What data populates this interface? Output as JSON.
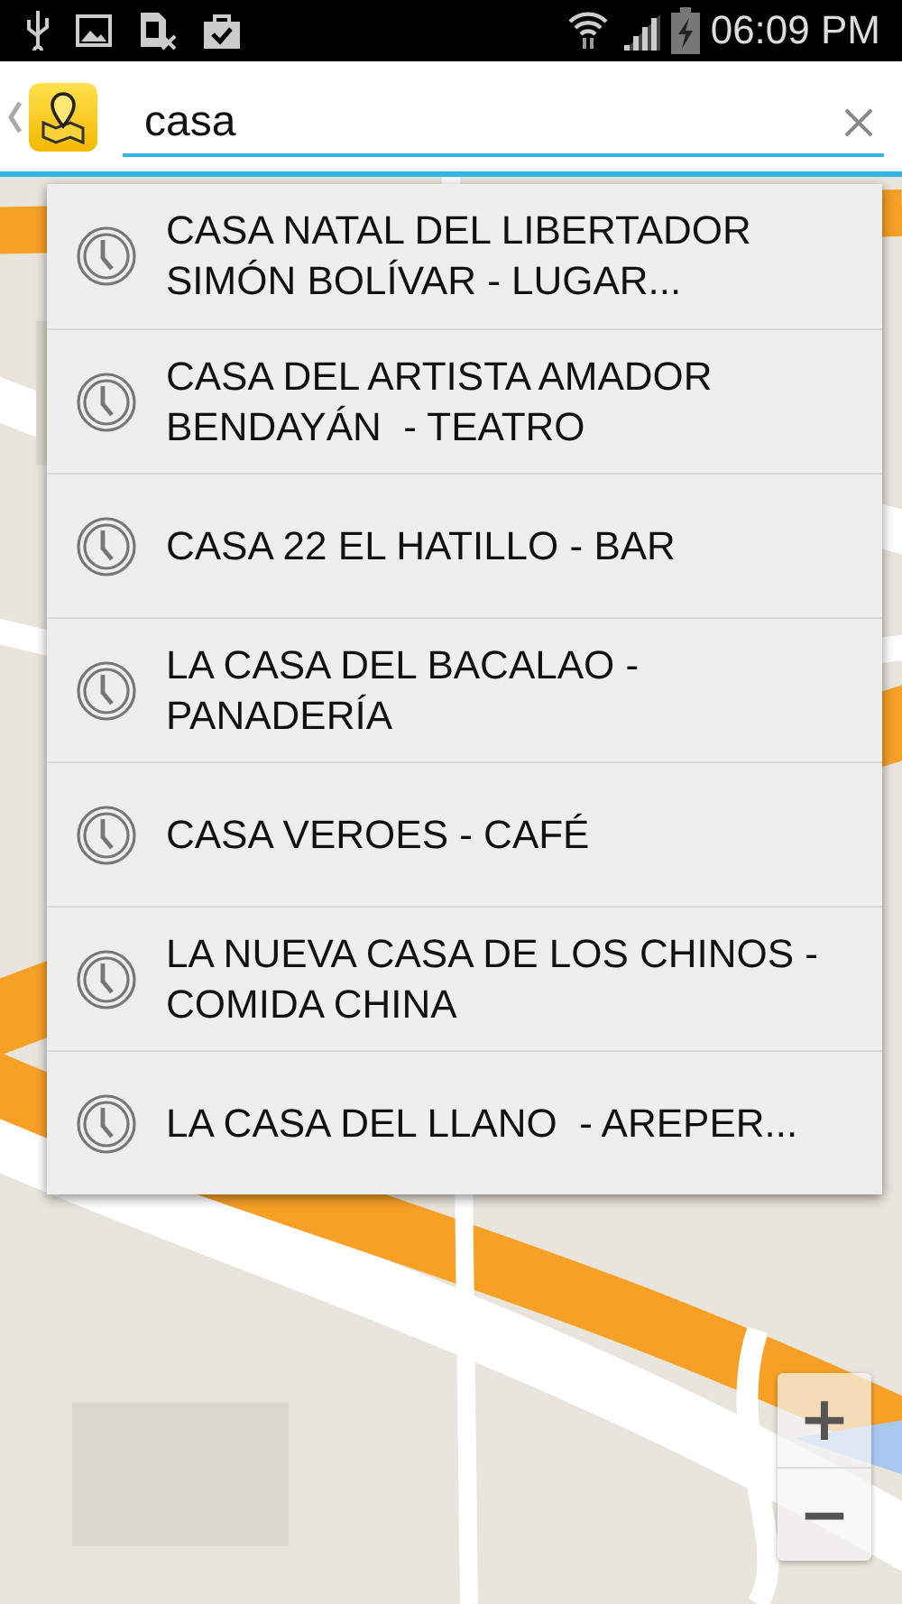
{
  "status_bar": {
    "time": "06:09 PM"
  },
  "search": {
    "value": "casa"
  },
  "suggestions": [
    {
      "text": "CASA NATAL DEL LIBERTADOR SIMÓN BOLÍVAR - LUGAR..."
    },
    {
      "text": "CASA DEL ARTISTA AMADOR BENDAYÁN  - TEATRO"
    },
    {
      "text": "CASA 22 EL HATILLO - BAR"
    },
    {
      "text": "LA CASA DEL BACALAO - PANADERÍA"
    },
    {
      "text": "CASA VEROES - CAFÉ"
    },
    {
      "text": "LA NUEVA CASA DE LOS CHINOS - COMIDA CHINA"
    },
    {
      "text": "LA CASA DEL LLANO  - AREPER..."
    }
  ],
  "map": {
    "kind": "picture",
    "zoom_buttons": [
      "+",
      "−"
    ]
  }
}
